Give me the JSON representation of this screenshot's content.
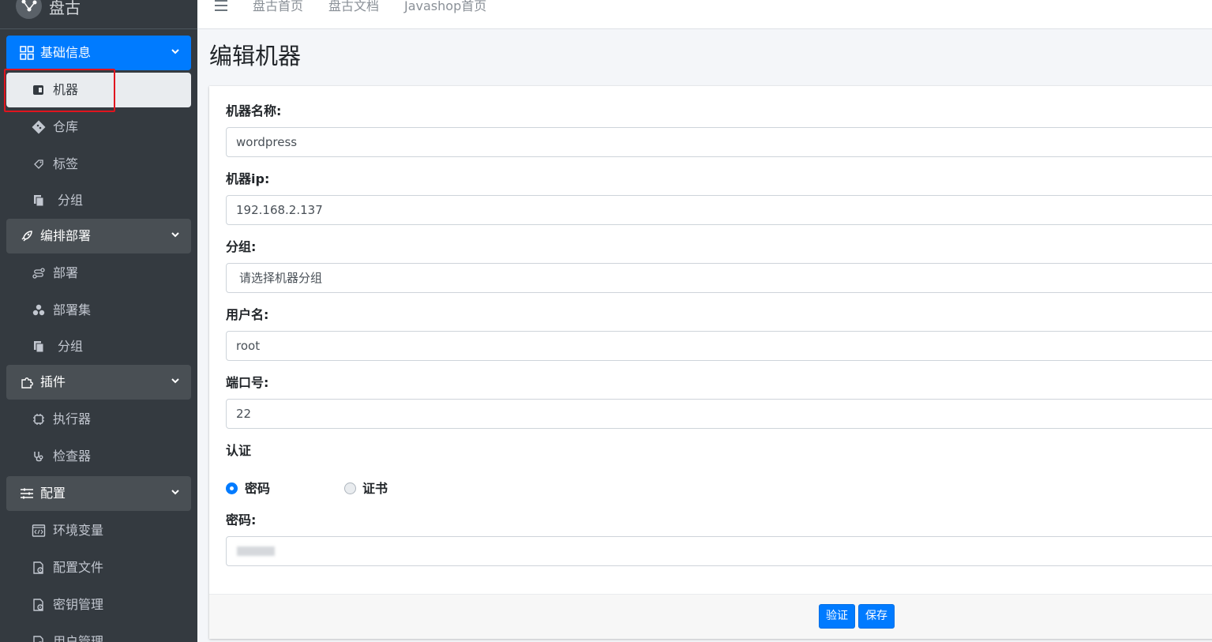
{
  "brand": {
    "name": "盘古",
    "icon": "share-nodes-icon"
  },
  "topnav": {
    "menu_icon": "hamburger-icon",
    "links": [
      "盘古首页",
      "盘古文档",
      "Javashop首页"
    ]
  },
  "sidebar": {
    "groups": [
      {
        "label": "基础信息",
        "icon": "grid-icon",
        "active": true,
        "items": [
          {
            "label": "机器",
            "icon": "hdd-icon",
            "active": true
          },
          {
            "label": "仓库",
            "icon": "git-icon"
          },
          {
            "label": "标签",
            "icon": "tag-icon"
          },
          {
            "label": "分组",
            "icon": "copy-icon"
          }
        ]
      },
      {
        "label": "编排部署",
        "icon": "rocket-icon",
        "items": [
          {
            "label": "部署",
            "icon": "route-icon"
          },
          {
            "label": "部署集",
            "icon": "cubes-icon"
          },
          {
            "label": "分组",
            "icon": "copy-icon"
          }
        ]
      },
      {
        "label": "插件",
        "icon": "puzzle-icon",
        "items": [
          {
            "label": "执行器",
            "icon": "chip-icon"
          },
          {
            "label": "检查器",
            "icon": "stethoscope-icon"
          }
        ]
      },
      {
        "label": "配置",
        "icon": "sliders-icon",
        "items": [
          {
            "label": "环境变量",
            "icon": "code-window-icon"
          },
          {
            "label": "配置文件",
            "icon": "file-gear-icon"
          },
          {
            "label": "密钥管理",
            "icon": "file-gear-icon"
          },
          {
            "label": "用户管理",
            "icon": "file-gear-icon"
          }
        ]
      }
    ]
  },
  "page": {
    "title": "编辑机器"
  },
  "form": {
    "name": {
      "label": "机器名称:",
      "value": "wordpress"
    },
    "ip": {
      "label": "机器ip:",
      "value": "192.168.2.137"
    },
    "group": {
      "label": "分组:",
      "value": "请选择机器分组"
    },
    "username": {
      "label": "用户名:",
      "value": "root"
    },
    "port": {
      "label": "端口号:",
      "value": "22"
    },
    "auth": {
      "label": "认证",
      "options": [
        "密码",
        "证书"
      ],
      "selected": "密码"
    },
    "password": {
      "label": "密码:",
      "value": ""
    }
  },
  "buttons": {
    "verify": "验证",
    "save": "保存"
  },
  "colors": {
    "primary": "#007bff",
    "sidebar": "#343a40",
    "highlight": "#e0141e"
  }
}
